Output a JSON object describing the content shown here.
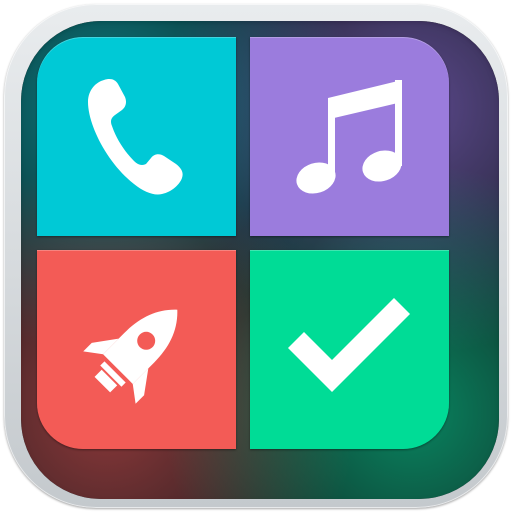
{
  "tiles": [
    {
      "id": "phone",
      "icon": "phone-icon",
      "color": "#00c9d6"
    },
    {
      "id": "music",
      "icon": "music-note-icon",
      "color": "#9b7cdd"
    },
    {
      "id": "rocket",
      "icon": "rocket-icon",
      "color": "#f35b56"
    },
    {
      "id": "check",
      "icon": "checkmark-icon",
      "color": "#00dc96"
    }
  ],
  "glyph_color": "#ffffff",
  "frame_color": "#d9dde0",
  "bezel_color": "#131a1d"
}
